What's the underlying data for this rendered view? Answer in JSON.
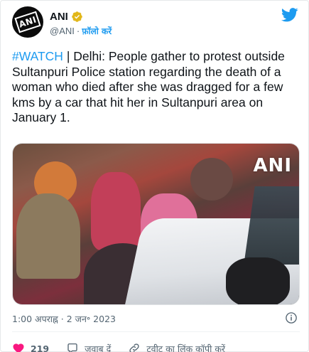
{
  "account": {
    "display_name": "ANI",
    "handle": "@ANI",
    "separator": "·",
    "follow_label": "फ़ॉलो करें",
    "avatar_logo_text": "ANI"
  },
  "tweet": {
    "hashtag": "#WATCH",
    "body": " | Delhi: People gather to protest outside Sultanpuri Police station regarding the death of a woman who died after she was dragged for a few kms by a car that hit her in Sultanpuri area on January 1."
  },
  "media": {
    "watermark": "ANI"
  },
  "meta": {
    "timestamp": "1:00 अपराह्न · 2 जन॰ 2023"
  },
  "actions": {
    "like_count": "219",
    "reply_label": "जवाब दें",
    "copy_link_label": "ट्वीट का लिंक कॉपी करें"
  },
  "colors": {
    "accent": "#1d9bf0",
    "like": "#f91880",
    "verified": "#e2b719",
    "text": "#0f1419",
    "secondary": "#536471"
  },
  "icons": {
    "verified": "verified-badge-icon",
    "brand": "twitter-bird-icon",
    "info": "info-icon",
    "like": "heart-icon",
    "reply": "speech-bubble-icon",
    "copy_link": "link-icon"
  }
}
